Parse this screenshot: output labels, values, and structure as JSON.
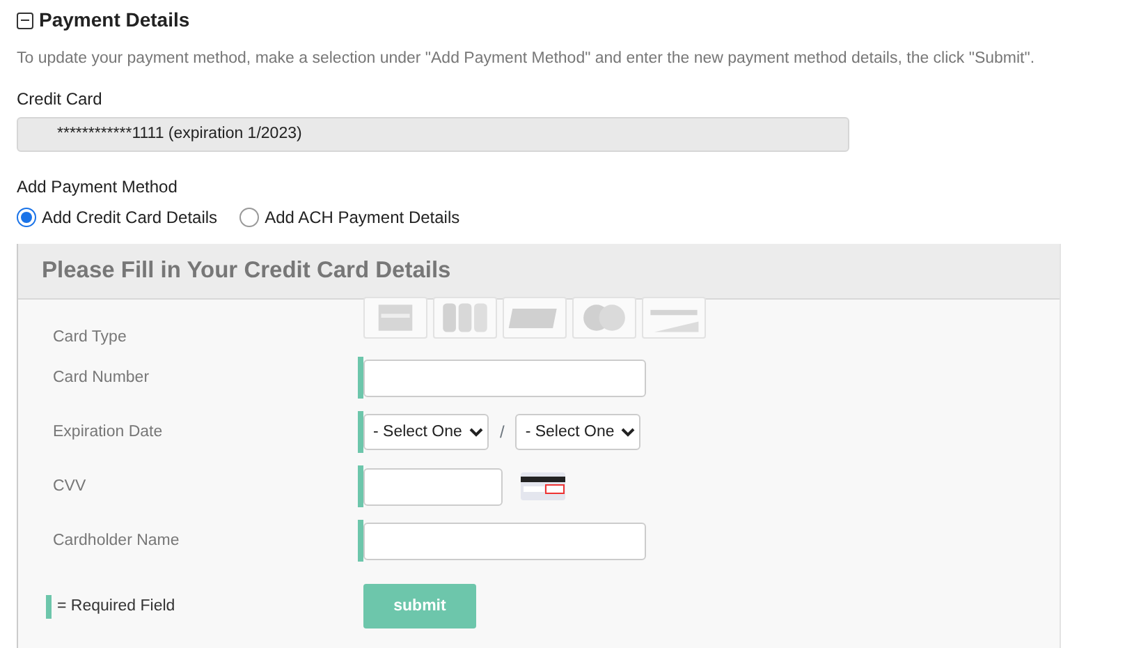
{
  "section": {
    "title": "Payment Details",
    "expanded": true
  },
  "description": "To update your payment method, make a selection under \"Add Payment Method\" and enter the new payment method details, the click \"Submit\".",
  "current_card": {
    "label": "Credit Card",
    "value": "************1111 (expiration 1/2023)"
  },
  "payment_method": {
    "label": "Add Payment Method",
    "options": [
      {
        "label": "Add Credit Card Details",
        "selected": true
      },
      {
        "label": "Add ACH Payment Details",
        "selected": false
      }
    ]
  },
  "form": {
    "title": "Please Fill in Your Credit Card Details",
    "fields": [
      {
        "kind": "card_types",
        "label": "Card Type",
        "required": false
      },
      {
        "kind": "text",
        "label": "Card Number",
        "required": true
      },
      {
        "kind": "expiration",
        "label": "Expiration Date",
        "required": true,
        "month": "- Select One",
        "separator": "/",
        "year": "- Select One"
      },
      {
        "kind": "cvv",
        "label": "CVV",
        "required": true
      },
      {
        "kind": "text",
        "label": "Cardholder Name",
        "required": true
      }
    ],
    "legend": "= Required Field",
    "submit": "submit"
  }
}
